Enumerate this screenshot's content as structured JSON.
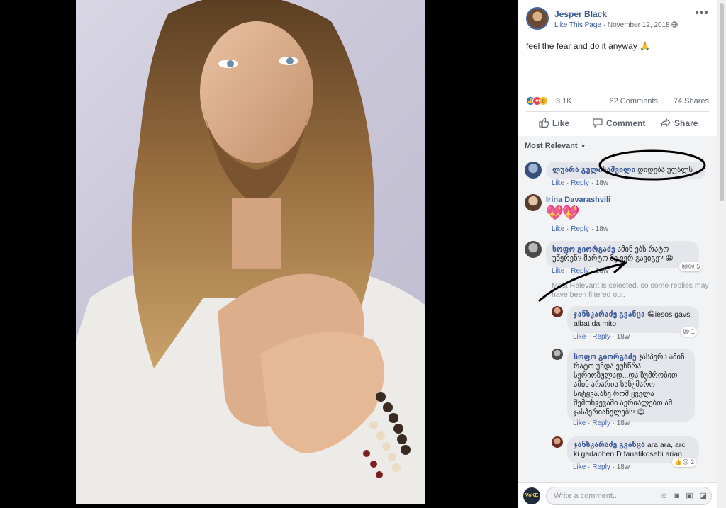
{
  "post": {
    "page_name": "Jesper Black",
    "like_page": "Like This Page",
    "separator": " · ",
    "date": "November 12, 2018",
    "privacy_icon": "globe-icon",
    "more_icon": "ellipsis-icon",
    "text": "feel the fear and do it anyway",
    "text_emoji": "🙏"
  },
  "stats": {
    "reaction_icons": [
      "like-icon",
      "love-icon",
      "wow-icon"
    ],
    "reactions": "3.1K",
    "comments": "62 Comments",
    "shares": "74 Shares"
  },
  "actions": {
    "like": "Like",
    "comment": "Comment",
    "share": "Share"
  },
  "sort": {
    "label": "Most Relevant"
  },
  "comments": [
    {
      "author": "ლუარა გულისაშვილი",
      "text": "დიდება უფალს",
      "like": "Like",
      "reply": "Reply",
      "time": "18w"
    },
    {
      "author": "Irina Davarashvili",
      "text": "💖💖",
      "like": "Like",
      "reply": "Reply",
      "time": "18w"
    },
    {
      "author": "სოფო გიორგაძე",
      "text": "ამინ ებს რატო უწერენ? მარტო მე ვერ გავიგე? 😀",
      "like": "Like",
      "reply": "Reply",
      "time": "18w",
      "reactions": "😆😢 5"
    }
  ],
  "filter_note": "Most Relevant is selected, so some replies may have been filtered out.",
  "replies": [
    {
      "author": "ჯანსკარაძე გვანცა",
      "text": "😀iesos gavs albat da mito",
      "like": "Like",
      "reply": "Reply",
      "time": "18w",
      "reactions": "😆 1"
    },
    {
      "author": "სოფო გიორგაძე",
      "text": "ჯასპერს ამინ რატო უნდა ეუსწრა სერიოზულად...და ზუმრობით ამინ არარის საზუმარო სიტყვა.ასე რომ ყველა შემთხვევაში აერიალებთ ამ ჯასპერიანელებს! 😫",
      "like": "Like",
      "reply": "Reply",
      "time": "18w"
    },
    {
      "author": "ჯანსკარაძე გვანცა",
      "text": "ara ara, arc ki gadaoben:D fanatikosebi arian",
      "like": "Like",
      "reply": "Reply",
      "time": "18w",
      "reactions": "👍😢 2"
    }
  ],
  "composer": {
    "placeholder": "Write a comment...",
    "avatar_text": "VoKE",
    "icons": [
      "smiley-icon",
      "camera-icon",
      "gif-icon",
      "sticker-icon"
    ]
  },
  "colors": {
    "link": "#385898",
    "accent": "#4267b2",
    "annotation": "#000000"
  }
}
